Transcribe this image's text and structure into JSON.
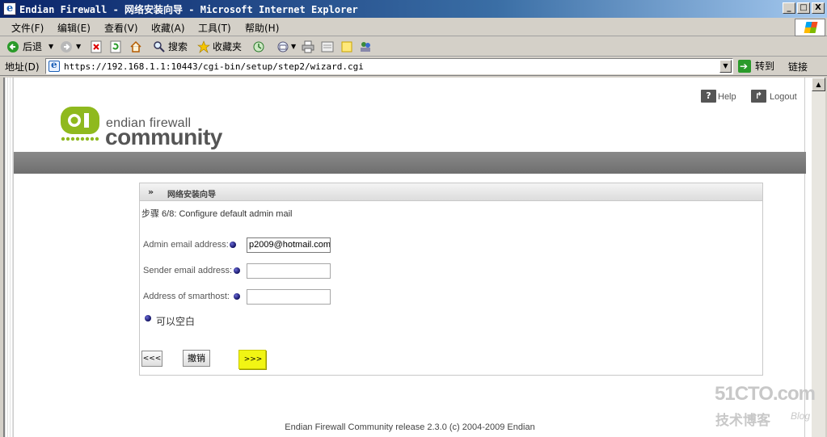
{
  "window": {
    "title": "Endian Firewall - 网络安装向导 - Microsoft Internet Explorer",
    "controls": {
      "minimize": "_",
      "maximize": "□",
      "close": "X"
    }
  },
  "menubar": {
    "items": [
      "文件(F)",
      "编辑(E)",
      "查看(V)",
      "收藏(A)",
      "工具(T)",
      "帮助(H)"
    ]
  },
  "toolbar": {
    "back": "后退",
    "search": "搜索",
    "favorites": "收藏夹"
  },
  "addressbar": {
    "label": "地址(D)",
    "url": "https://192.168.1.1:10443/cgi-bin/setup/step2/wizard.cgi",
    "go": "转到",
    "links": "链接"
  },
  "page": {
    "help": "Help",
    "logout": "Logout",
    "logo_small": "endian firewall",
    "logo_big": "community",
    "panel_chevron": "»",
    "panel_title": "网络安装向导",
    "step": "步骤  6/8: Configure default admin mail",
    "fields": {
      "admin_label": "Admin email address:",
      "admin_value": "p2009@hotmail.com",
      "sender_label": "Sender email address:",
      "sender_value": "",
      "smarthost_label": "Address of smarthost:",
      "smarthost_value": ""
    },
    "note": "可以空白",
    "buttons": {
      "back": "<<<",
      "cancel": "撤销",
      "next": ">>>"
    },
    "footer": "Endian Firewall Community release 2.3.0 (c) 2004-2009 Endian"
  },
  "watermark": {
    "top": "51CTO.com",
    "bottom": "技术博客",
    "blog": "Blog"
  },
  "colors": {
    "accent_green": "#8fb91e",
    "logo_gray": "#555555",
    "highlight_yellow": "#f1f514",
    "bullet_navy": "#101060"
  }
}
